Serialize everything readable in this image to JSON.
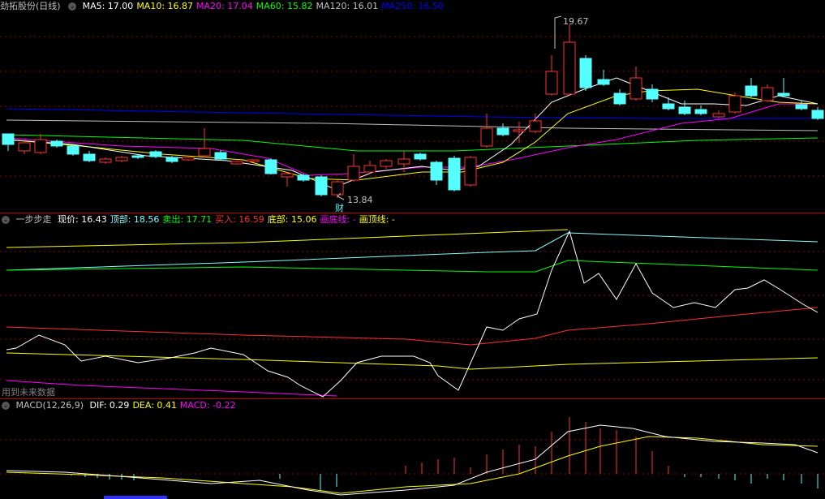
{
  "price_panel": {
    "title": "劲拓股份(日线)",
    "indicators": [
      {
        "label": "MA5: 17.00",
        "color": "#ffffff"
      },
      {
        "label": "MA10: 16.87",
        "color": "#ffff00"
      },
      {
        "label": "MA20: 17.04",
        "color": "#ff00ff"
      },
      {
        "label": "MA60: 15.82",
        "color": "#00ff00"
      },
      {
        "label": "MA120: 16.01",
        "color": "#c0c0c0"
      },
      {
        "label": "MA250: 16.50",
        "color": "#0000ff"
      }
    ],
    "high_label": "19.67",
    "low_label": "13.84",
    "tag": "财"
  },
  "step_panel": {
    "title": "一步步走",
    "items": [
      {
        "label": "现价: 16.43",
        "color": "#ffffff"
      },
      {
        "label": "顶部: 18.56",
        "color": "#80ffff"
      },
      {
        "label": "卖出: 17.71",
        "color": "#00ff00"
      },
      {
        "label": "买入: 16.59",
        "color": "#ff3030"
      },
      {
        "label": "底部: 15.06",
        "color": "#ffff00"
      },
      {
        "label": "画底线: -",
        "color": "#ff00ff"
      },
      {
        "label": "画顶线: -",
        "color": "#ffff00"
      }
    ],
    "footnote": "用到未来数据"
  },
  "macd_panel": {
    "title": "MACD(12,26,9)",
    "items": [
      {
        "label": "DIF: 0.29",
        "color": "#ffffff"
      },
      {
        "label": "DEA: 0.41",
        "color": "#ffff00"
      },
      {
        "label": "MACD: -0.22",
        "color": "#ff00ff"
      }
    ]
  },
  "colors": {
    "up": "#ff3232",
    "down": "#54ffff",
    "grid": "#8b0000",
    "separator": "#c00000"
  }
}
